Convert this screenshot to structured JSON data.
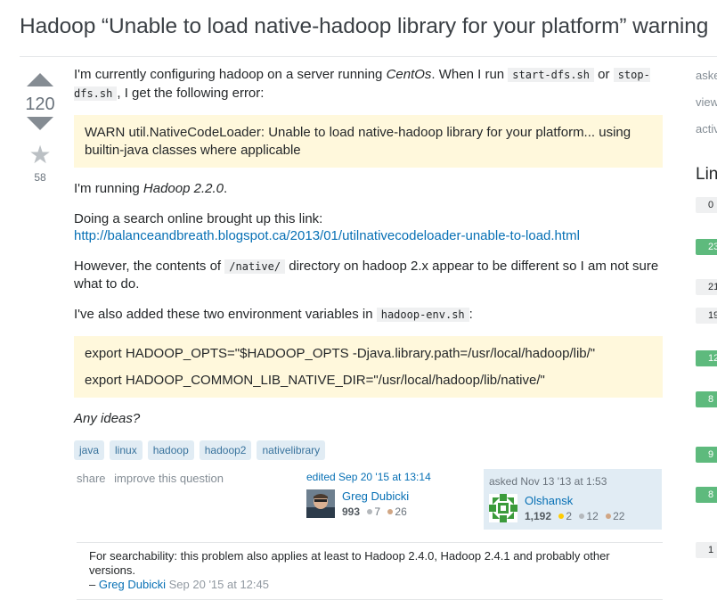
{
  "question": {
    "title": "Hadoop “Unable to load native-hadoop library for your platform” warning",
    "votes": "120",
    "favorites": "58",
    "body": {
      "p1_before": "I'm currently configuring hadoop on a server running ",
      "p1_em": "CentOs",
      "p1_mid": ". When I run ",
      "p1_code1": "start-dfs.sh",
      "p1_or": " or ",
      "p1_code2": "stop-dfs.sh",
      "p1_after": ", I get the following error:",
      "warn": "WARN util.NativeCodeLoader: Unable to load native-hadoop library for your platform... using builtin-java classes where applicable",
      "p2_before": "I'm running ",
      "p2_em": "Hadoop 2.2.0",
      "p2_after": ".",
      "p3_text": "Doing a search online brought up this link: ",
      "p3_link": "http://balanceandbreath.blogspot.ca/2013/01/utilnativecodeloader-unable-to-load.html",
      "p4_before": "However, the contents of ",
      "p4_code": "/native/",
      "p4_after": " directory on hadoop 2.x appear to be different so I am not sure what to do.",
      "p5_before": "I've also added these two environment variables in ",
      "p5_code": "hadoop-env.sh",
      "p5_after": ":",
      "env1": "export HADOOP_OPTS=\"$HADOOP_OPTS -Djava.library.path=/usr/local/hadoop/lib/\"",
      "env2": "export HADOOP_COMMON_LIB_NATIVE_DIR=\"/usr/local/hadoop/lib/native/\"",
      "closing": "Any ideas?"
    },
    "tags": [
      "java",
      "linux",
      "hadoop",
      "hadoop2",
      "nativelibrary"
    ],
    "menu": {
      "share": "share",
      "improve": "improve this question"
    },
    "editor": {
      "action": "edited Sep 20 '15 at 13:14",
      "name": "Greg Dubicki",
      "rep": "993",
      "silver": "7",
      "bronze": "26"
    },
    "asker": {
      "action": "asked Nov 13 '13 at 1:53",
      "name": "Olshansk",
      "rep": "1,192",
      "gold": "2",
      "silver": "12",
      "bronze": "22"
    }
  },
  "comment": {
    "text": "For searchability: this problem also applies at least to Hadoop 2.4.0, Hadoop 2.4.1 and probably other versions.",
    "dash": "–",
    "user": "Greg Dubicki",
    "date": "Sep 20 '15 at 12:45"
  },
  "sidebar": {
    "labels": [
      "aske",
      "view",
      "activ"
    ],
    "heading": "Lin",
    "badges": [
      {
        "text": "0",
        "kind": "gray"
      },
      {
        "text": "23",
        "kind": "green"
      },
      {
        "text": "21",
        "kind": "gray"
      },
      {
        "text": "19",
        "kind": "gray"
      },
      {
        "text": "12",
        "kind": "green"
      },
      {
        "text": "8",
        "kind": "green"
      },
      {
        "text": "9",
        "kind": "green"
      },
      {
        "text": "8",
        "kind": "green"
      },
      {
        "text": "1",
        "kind": "gray"
      }
    ]
  },
  "colors": {
    "link": "#0770b5",
    "tag_bg": "#e1ecf4",
    "tag_text": "#39739d",
    "quote_bg": "#fff8dc",
    "accepted_green": "#5eba7d"
  }
}
